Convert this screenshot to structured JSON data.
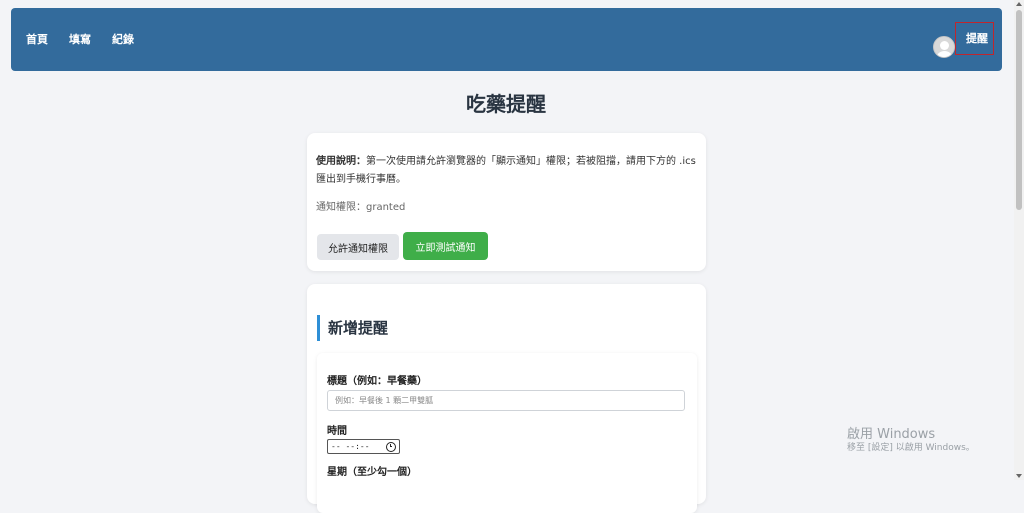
{
  "nav": {
    "links": [
      "首頁",
      "填寫",
      "紀錄"
    ],
    "reminder_label": "提醒"
  },
  "page": {
    "title": "吃藥提醒"
  },
  "info": {
    "usage_label": "使用說明：",
    "usage_text": "第一次使用請允許瀏覽器的「顯示通知」權限；若被阻擋，請用下方的 .ics 匯出到手機行事曆。",
    "permission_text": "通知權限：granted",
    "allow_button": "允許通知權限",
    "test_button": "立即測試通知"
  },
  "form": {
    "section_title": "新增提醒",
    "title_label": "標題（例如：早餐藥）",
    "title_placeholder": "例如：早餐後 1 顆二甲雙胍",
    "time_label": "時間",
    "time_value": "-- --:--",
    "weekday_label": "星期（至少勾一個）"
  },
  "watermark": {
    "line1": "啟用 Windows",
    "line2": "移至 [設定] 以啟用 Windows。"
  },
  "colors": {
    "navbar": "#336b9c",
    "accent_green": "#3fae49",
    "section_bar": "#2e8fd6",
    "highlight_box": "#c0262d"
  }
}
